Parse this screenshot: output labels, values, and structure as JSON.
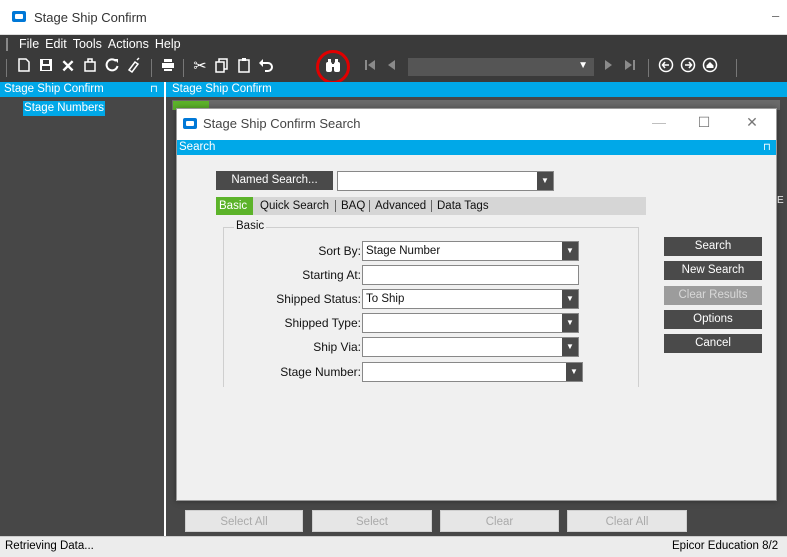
{
  "window": {
    "title": "Stage Ship Confirm",
    "minimize_glyph": "–"
  },
  "menubar": {
    "items": [
      "File",
      "Edit",
      "Tools",
      "Actions",
      "Help"
    ]
  },
  "toolbar": {
    "icons": [
      "new-icon",
      "save-icon",
      "delete-icon",
      "attach-icon",
      "refresh-icon",
      "clear-icon",
      "print-icon",
      "cut-icon",
      "copy-icon",
      "paste-icon",
      "undo-icon",
      "search-binoculars-icon",
      "first-record-icon",
      "previous-record-icon",
      "next-record-icon",
      "last-record-icon",
      "back-icon",
      "forward-icon",
      "home-icon"
    ],
    "highlight_color": "#e00000"
  },
  "left_panel": {
    "header": "Stage Ship Confirm",
    "pin": "⊓",
    "tree_item": "Stage Numbers"
  },
  "main_panel": {
    "header": "Stage Ship Confirm",
    "edge_glyph": "E"
  },
  "bottom_buttons": {
    "select_all": "Select All",
    "select": "Select",
    "clear": "Clear",
    "clear_all": "Clear All"
  },
  "status_bar": {
    "left": "Retrieving Data...",
    "right": "Epicor Education  8/2"
  },
  "dialog": {
    "title": "Stage Ship Confirm Search",
    "controls": {
      "minimize": "—",
      "maximize": "☐",
      "close": "✕"
    },
    "bar_label": "Search",
    "named_search_button": "Named Search...",
    "named_search_value": "",
    "tabs": [
      "Basic",
      "Quick Search",
      "BAQ",
      "Advanced",
      "Data Tags"
    ],
    "active_tab": "Basic",
    "group_label": "Basic",
    "fields": [
      {
        "label": "Sort By:",
        "value": "Stage Number",
        "type": "combo"
      },
      {
        "label": "Starting At:",
        "value": "",
        "type": "text"
      },
      {
        "label": "Shipped Status:",
        "value": "To Ship",
        "type": "combo"
      },
      {
        "label": "Shipped Type:",
        "value": "",
        "type": "combo"
      },
      {
        "label": "Ship Via:",
        "value": "",
        "type": "combo"
      },
      {
        "label": "Stage Number:",
        "value": "",
        "type": "combo"
      }
    ],
    "buttons": {
      "search": "Search",
      "new_search": "New Search",
      "clear_results": "Clear Results",
      "options": "Options",
      "cancel": "Cancel"
    }
  },
  "colors": {
    "accent": "#00a8e8",
    "active_tab": "#5cb32a",
    "dark_chrome": "#3a3a3a",
    "panel_bg": "#474747"
  }
}
